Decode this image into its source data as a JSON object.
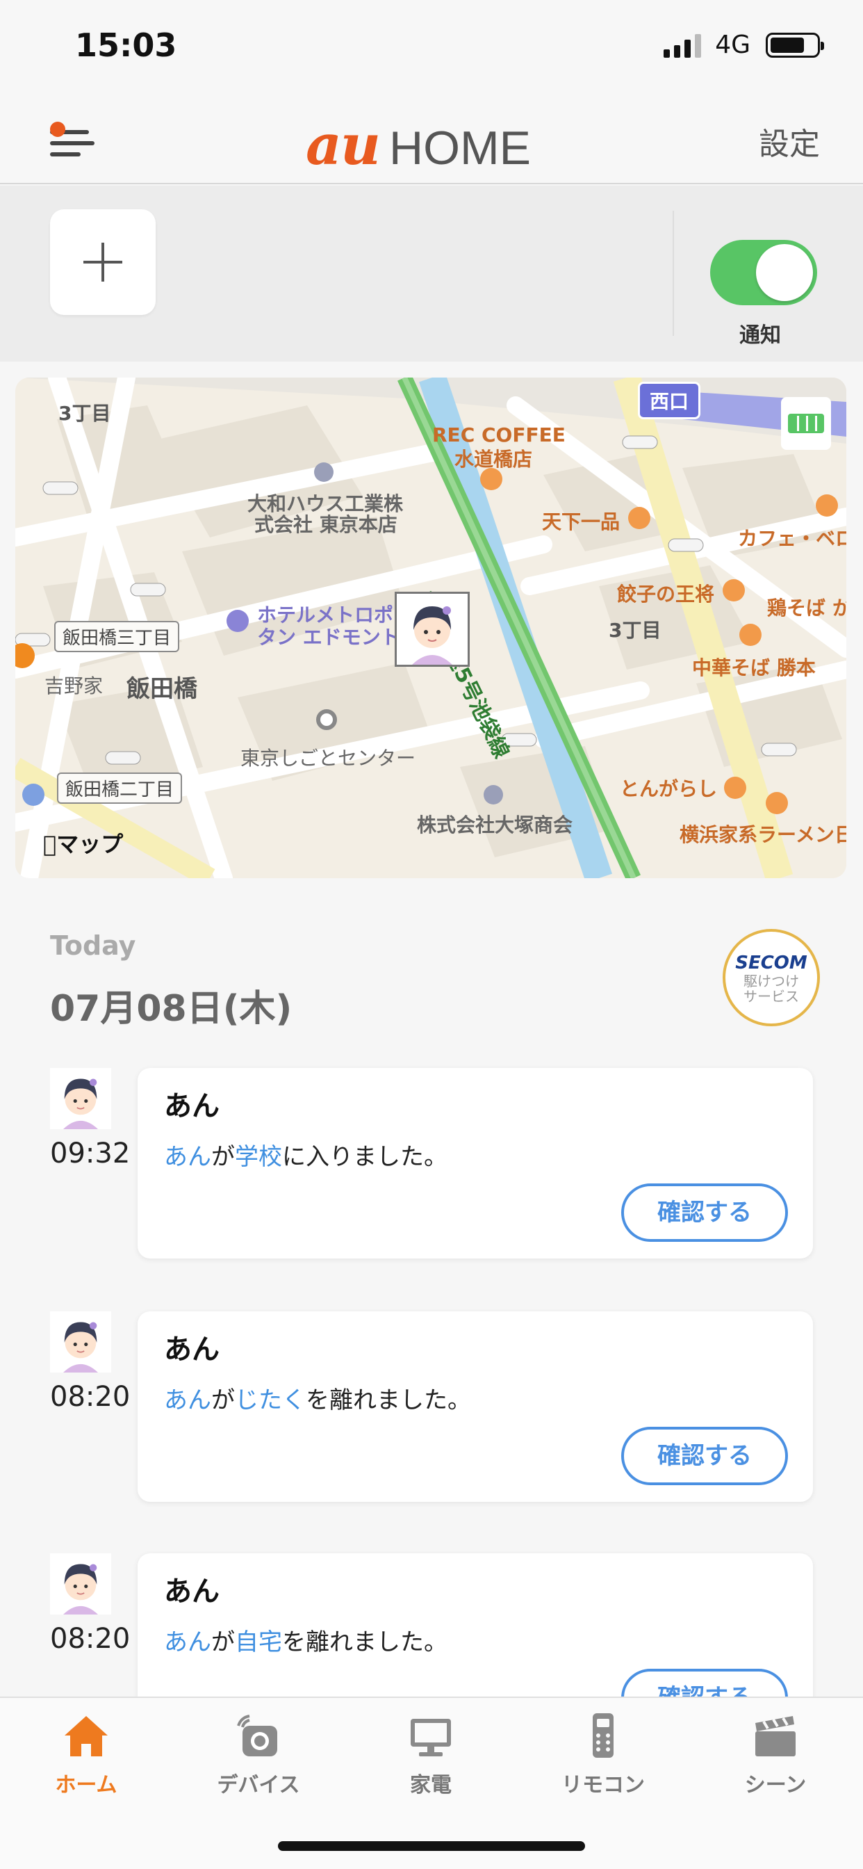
{
  "status_bar": {
    "time": "15:03",
    "network": "4G"
  },
  "header": {
    "logo_au": "au",
    "logo_home": "HOME",
    "settings_label": "設定"
  },
  "controls": {
    "notification_label": "通知",
    "notification_on": true
  },
  "map": {
    "exit_label": "西口",
    "labels": [
      "3丁目",
      "REC COFFEE",
      "水道橋店",
      "大和ハウス工業株",
      "式会社 東京本店",
      "天下一品",
      "カフェ・ベロ",
      "餃子の王将",
      "鶏そば か",
      "3丁目",
      "ホテルメトロポ",
      "タン エドモント",
      "飯田橋三丁目",
      "吉野家",
      "飯田橋",
      "中華そば 勝本",
      "東京しごとセンター",
      "飯田橋二丁目",
      "とんがらし",
      "横浜家系ラーメン日",
      "株式会社大塚商会",
      "首都高速5号池袋線"
    ],
    "attribution": "マップ"
  },
  "timeline": {
    "today_label": "Today",
    "date": "07月08日(木)",
    "secom": {
      "logo": "SECOM",
      "line1": "駆けつけ",
      "line2": "サービス"
    },
    "events": [
      {
        "time": "09:32",
        "name": "あん",
        "subject": "あん",
        "particle": "が",
        "place": "学校",
        "action": "に入りました。",
        "button": "確認する"
      },
      {
        "time": "08:20",
        "name": "あん",
        "subject": "あん",
        "particle": "が",
        "place": "じたく",
        "action": "を離れました。",
        "button": "確認する"
      },
      {
        "time": "08:20",
        "name": "あん",
        "subject": "あん",
        "particle": "が",
        "place": "自宅",
        "action": "を離れました。",
        "button": "確認する"
      }
    ]
  },
  "tabbar": {
    "tabs": [
      {
        "label": "ホーム",
        "icon": "home-icon",
        "active": true
      },
      {
        "label": "デバイス",
        "icon": "camera-icon",
        "active": false
      },
      {
        "label": "家電",
        "icon": "monitor-icon",
        "active": false
      },
      {
        "label": "リモコン",
        "icon": "remote-icon",
        "active": false
      },
      {
        "label": "シーン",
        "icon": "clapper-icon",
        "active": false
      }
    ]
  },
  "colors": {
    "accent": "#e85a1f",
    "toggle_on": "#58c565",
    "link": "#3f8fe0",
    "button": "#4a90e2",
    "tab_active": "#ee7a1f"
  }
}
